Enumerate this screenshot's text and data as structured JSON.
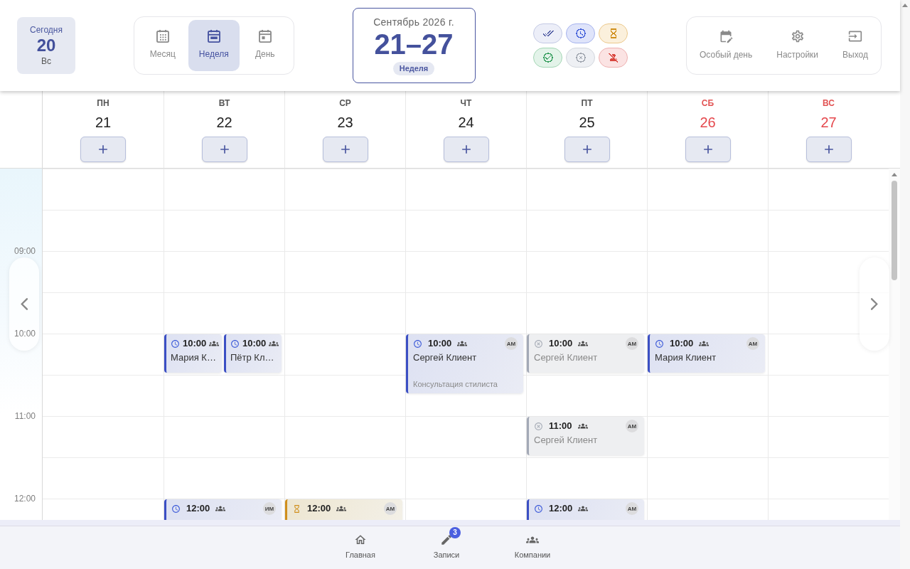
{
  "header": {
    "today": {
      "label": "Сегодня",
      "day": "20",
      "weekday": "Вс"
    },
    "views": [
      {
        "label": "Месяц",
        "selected": false
      },
      {
        "label": "Неделя",
        "selected": true
      },
      {
        "label": "День",
        "selected": false
      }
    ],
    "period": {
      "month": "Сентябрь 2026 г.",
      "range": "21–27",
      "badge": "Неделя"
    },
    "status_filters": [
      {
        "kind": "completed",
        "color": "#4a56a0"
      },
      {
        "kind": "scheduled",
        "color": "#3d5bd9"
      },
      {
        "kind": "pending",
        "color": "#d08f1c"
      },
      {
        "kind": "confirmed",
        "color": "#2e9a57"
      },
      {
        "kind": "cancelled",
        "color": "#9ba1ab"
      },
      {
        "kind": "no_show",
        "color": "#d9463f"
      }
    ],
    "actions": [
      {
        "label": "Особый день"
      },
      {
        "label": "Настройки"
      },
      {
        "label": "Выход"
      }
    ]
  },
  "days": [
    {
      "weekday": "ПН",
      "date": "21",
      "weekend": false
    },
    {
      "weekday": "ВТ",
      "date": "22",
      "weekend": false,
      "events": [
        {
          "kind": "scheduled",
          "time": "10:00",
          "name": "Мария К…"
        },
        {
          "kind": "scheduled",
          "time": "10:00",
          "name": "Пётр Кл…"
        },
        {
          "kind": "scheduled",
          "time": "12:00",
          "avatar": "ИМ"
        }
      ]
    },
    {
      "weekday": "СР",
      "date": "23",
      "weekend": false,
      "events": [
        {
          "kind": "pending",
          "time": "12:00",
          "avatar": "АМ"
        }
      ]
    },
    {
      "weekday": "ЧТ",
      "date": "24",
      "weekend": false,
      "events": [
        {
          "kind": "scheduled",
          "time": "10:00",
          "name": "Сергей Клиент",
          "avatar": "АМ",
          "service": "Консультация стилиста"
        }
      ]
    },
    {
      "weekday": "ПТ",
      "date": "25",
      "weekend": false,
      "events": [
        {
          "kind": "cancelled",
          "time": "10:00",
          "name": "Сергей Клиент",
          "avatar": "АМ"
        },
        {
          "kind": "cancelled",
          "time": "11:00",
          "name": "Сергей Клиент",
          "avatar": "АМ"
        },
        {
          "kind": "scheduled",
          "time": "12:00",
          "avatar": "АМ"
        }
      ]
    },
    {
      "weekday": "СБ",
      "date": "26",
      "weekend": true,
      "events": [
        {
          "kind": "scheduled",
          "time": "10:00",
          "name": "Мария Клиент",
          "avatar": "АМ"
        }
      ]
    },
    {
      "weekday": "ВС",
      "date": "27",
      "weekend": true
    }
  ],
  "time_labels": [
    "09:00",
    "10:00",
    "11:00",
    "12:00"
  ],
  "bottom_nav": [
    {
      "label": "Главная",
      "selected": false
    },
    {
      "label": "Записи",
      "selected": false,
      "badge": "3"
    },
    {
      "label": "Компании",
      "selected": false
    }
  ]
}
